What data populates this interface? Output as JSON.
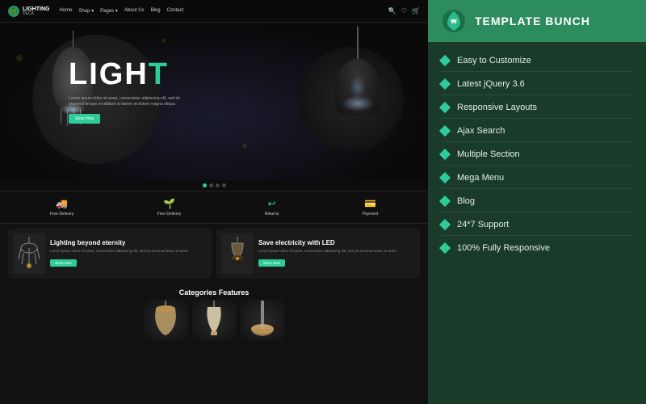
{
  "left": {
    "navbar": {
      "logo_text_main": "LIGHTING",
      "logo_text_sub": "DECA",
      "nav_links": [
        "Home",
        "Shop ▾",
        "Pages ▾",
        "About Us",
        "Blog",
        "Contact"
      ],
      "icons": [
        "🔍",
        "♡",
        "🛒"
      ]
    },
    "hero": {
      "title_part1": "LIGH",
      "title_part2": "T",
      "subtitle": "Lorem ipsum dolor sit amet, consectetur adipiscing elit, sed do eiusmod tempor incididunt ut labore et dolore magna aliqua.",
      "cta": "Shop Now"
    },
    "dots": [
      "",
      "",
      "",
      ""
    ],
    "features": [
      {
        "icon": "🚚",
        "label": "Free Delivery"
      },
      {
        "icon": "🌱",
        "label": "Free Delivery"
      },
      {
        "icon": "↩",
        "label": "Returns"
      },
      {
        "icon": "💳",
        "label": "Payment"
      }
    ],
    "products": [
      {
        "title": "Lighting beyond eternity",
        "desc": "Lorem ipsum dolor sit amet, consectetur adipiscing elit, sed do eiusmod dolor sit amet",
        "btn": "Shop Now"
      },
      {
        "title": "Save electricity with LED",
        "desc": "Lorem ipsum dolor sit amet, consectetur adipiscing elit, sed do eiusmod dolor sit amet",
        "btn": "Shop Now"
      }
    ],
    "categories": {
      "title": "Categories Features",
      "items": [
        "🪔",
        "💡",
        "🔦"
      ]
    }
  },
  "right": {
    "brand_name": "TEMPLATE BUNCH",
    "features": [
      "Easy to Customize",
      "Latest jQuery 3.6",
      "Responsive Layouts",
      "Ajax Search",
      "Multiple Section",
      "Mega Menu",
      "Blog",
      "24*7 Support",
      "100% Fully Responsive"
    ]
  }
}
